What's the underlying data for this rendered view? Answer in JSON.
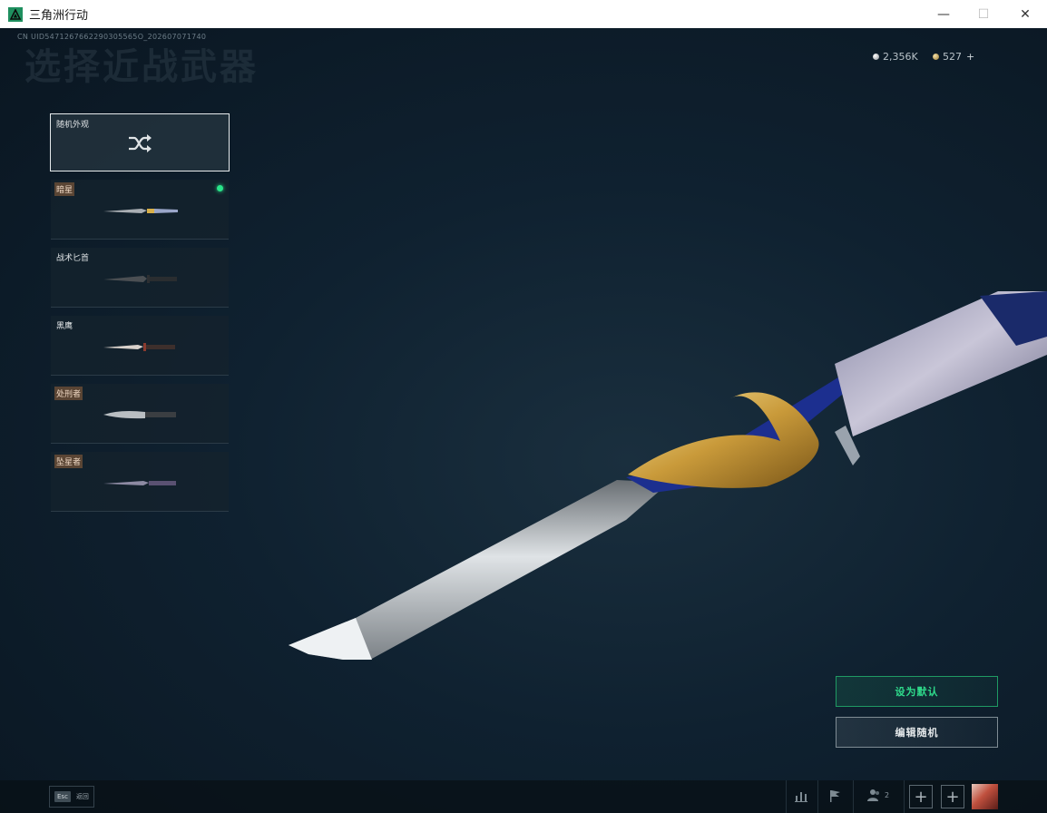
{
  "window": {
    "title": "三角洲行动",
    "controls": {
      "minimize": "—",
      "maximize": "☐",
      "close": "✕"
    }
  },
  "header": {
    "uid": "CN UID5471267662290305565O_202607071740",
    "heading": "选择近战武器"
  },
  "currency": {
    "silver_value": "2,356K",
    "gold_value": "527",
    "plus": "+"
  },
  "weapons": {
    "random": {
      "label": "随机外观",
      "icon": "shuffle-icon"
    },
    "items": [
      {
        "name": "暗星",
        "tagged": true,
        "equipped": true
      },
      {
        "name": "战术匕首",
        "tagged": false,
        "equipped": false
      },
      {
        "name": "黑鹰",
        "tagged": false,
        "equipped": false
      },
      {
        "name": "处刑者",
        "tagged": true,
        "equipped": false
      },
      {
        "name": "坠星者",
        "tagged": true,
        "equipped": false
      }
    ]
  },
  "actions": {
    "set_default": "设为默认",
    "edit_random": "编辑随机"
  },
  "bottom_bar": {
    "esc_key": "Esc",
    "esc_label": "返回",
    "team_count": "2",
    "add_slot_1": "+",
    "add_slot_2": "+"
  },
  "colors": {
    "accent_green": "#2fdc8c",
    "equipped_dot": "#29e58a",
    "tag_background": "#5a4534"
  }
}
